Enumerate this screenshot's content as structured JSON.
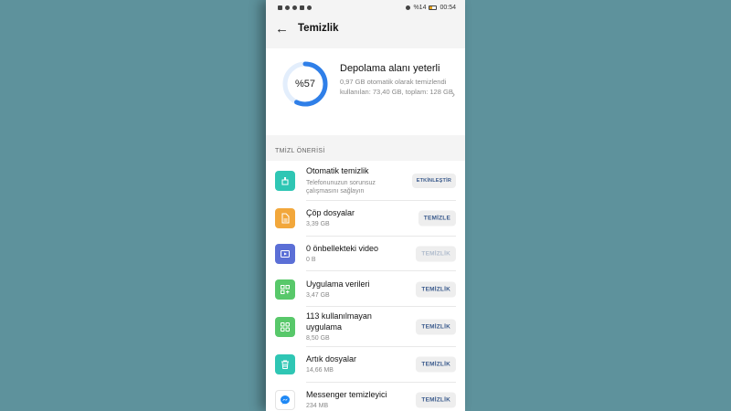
{
  "status_bar": {
    "battery": "%14",
    "time": "00:54"
  },
  "app_bar": {
    "title": "Temizlik"
  },
  "storage": {
    "percent_label": "%57",
    "percent": 57,
    "title": "Depolama alanı yeterli",
    "line1": "0,97 GB otomatik olarak temizlendi",
    "line2": "kullanılan: 73,40 GB, toplam: 128 GB"
  },
  "section": {
    "label": "TMİZL ÖNERİSİ"
  },
  "items": [
    {
      "title": "Otomatik temizlik",
      "subtitle": "Telefonunuzun sorunsuz çalışmasını sağlayın",
      "button": "ETKİNLEŞTİR",
      "icon": "broom-icon",
      "color": "#2fc6b4",
      "enabled": true
    },
    {
      "title": "Çöp dosyalar",
      "subtitle": "3,39 GB",
      "button": "TEMİZLE",
      "icon": "document-icon",
      "color": "#f2a73b",
      "enabled": true
    },
    {
      "title": "0 önbellekteki video",
      "subtitle": "0 B",
      "button": "TEMİZLİK",
      "icon": "video-icon",
      "color": "#5b6fd6",
      "enabled": false
    },
    {
      "title": "Uygulama verileri",
      "subtitle": "3,47 GB",
      "button": "TEMİZLİK",
      "icon": "app-data-icon",
      "color": "#58c86a",
      "enabled": true
    },
    {
      "title": "113 kullanılmayan uygulama",
      "subtitle": "8,50 GB",
      "button": "TEMİZLİK",
      "icon": "apps-grid-icon",
      "color": "#58c86a",
      "enabled": true
    },
    {
      "title": "Artık dosyalar",
      "subtitle": "14,66 MB",
      "button": "TEMİZLİK",
      "icon": "trash-icon",
      "color": "#2fc6b4",
      "enabled": true
    },
    {
      "title": "Messenger temizleyici",
      "subtitle": "234 MB",
      "button": "TEMİZLİK",
      "icon": "messenger-icon",
      "color": "#ffffff",
      "enabled": true
    }
  ]
}
